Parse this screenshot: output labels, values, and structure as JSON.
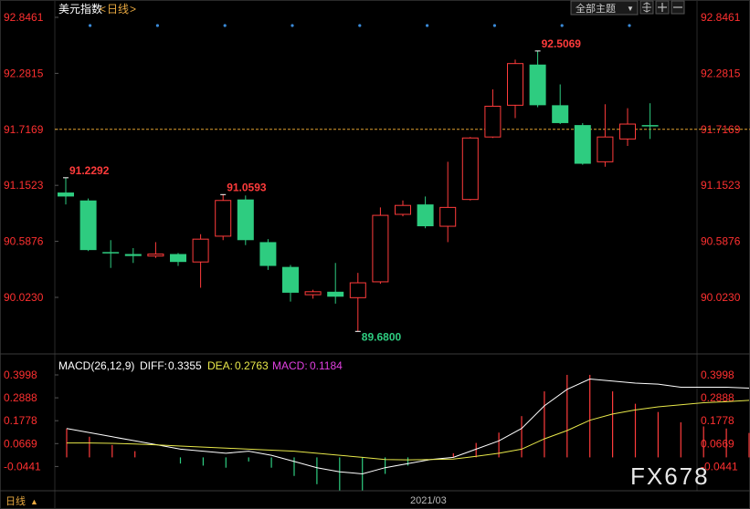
{
  "header": {
    "title": "美元指数",
    "period_open": "<",
    "period": "日线",
    "period_close": ">",
    "theme_selector": "全部主题",
    "theme_arrow": "▼"
  },
  "footer": {
    "period_label": "日线",
    "period_arrow": "▲",
    "date_label": "2021/03"
  },
  "watermark": "FX678",
  "colors": {
    "up": "#ff3b3b",
    "down": "#2ecc80",
    "grid": "#2a2a2a",
    "axis_text": "#ff3030",
    "diff_line": "#ffffff",
    "dea_line": "#e8e84a",
    "macd_text": "#e040e0",
    "current_price_line": "#e0a030",
    "marker_dots": "#3a8ad8"
  },
  "chart_data": [
    {
      "type": "candlestick",
      "title": "美元指数 日线",
      "y_ticks": [
        "92.8461",
        "92.2815",
        "91.7169",
        "91.1523",
        "90.5876",
        "90.0230"
      ],
      "ylim": [
        89.68,
        92.8461
      ],
      "current_price": 91.7169,
      "annotations": [
        {
          "text": "91.2292",
          "index": 0,
          "value": 91.2292
        },
        {
          "text": "91.0593",
          "index": 7,
          "value": 91.0593
        },
        {
          "text": "89.6800",
          "index": 13,
          "value": 89.68
        },
        {
          "text": "92.5069",
          "index": 21,
          "value": 92.5069
        }
      ],
      "candles": [
        {
          "open": 91.08,
          "close": 91.04,
          "high": 91.2292,
          "low": 90.96
        },
        {
          "open": 91.0,
          "close": 90.5,
          "high": 91.02,
          "low": 90.49
        },
        {
          "open": 90.48,
          "close": 90.47,
          "high": 90.6,
          "low": 90.32
        },
        {
          "open": 90.46,
          "close": 90.44,
          "high": 90.52,
          "low": 90.37
        },
        {
          "open": 90.44,
          "close": 90.46,
          "high": 90.58,
          "low": 90.42
        },
        {
          "open": 90.46,
          "close": 90.38,
          "high": 90.47,
          "low": 90.34
        },
        {
          "open": 90.38,
          "close": 90.61,
          "high": 90.66,
          "low": 90.12
        },
        {
          "open": 90.64,
          "close": 91.0,
          "high": 91.0593,
          "low": 90.6
        },
        {
          "open": 91.01,
          "close": 90.6,
          "high": 91.05,
          "low": 90.55
        },
        {
          "open": 90.58,
          "close": 90.34,
          "high": 90.61,
          "low": 90.3
        },
        {
          "open": 90.33,
          "close": 90.07,
          "high": 90.35,
          "low": 89.98
        },
        {
          "open": 90.05,
          "close": 90.08,
          "high": 90.1,
          "low": 90.01
        },
        {
          "open": 90.08,
          "close": 90.03,
          "high": 90.37,
          "low": 89.96
        },
        {
          "open": 90.02,
          "close": 90.17,
          "high": 90.27,
          "low": 89.68
        },
        {
          "open": 90.18,
          "close": 90.85,
          "high": 90.93,
          "low": 90.16
        },
        {
          "open": 90.86,
          "close": 90.95,
          "high": 91.0,
          "low": 90.84
        },
        {
          "open": 90.96,
          "close": 90.74,
          "high": 91.04,
          "low": 90.72
        },
        {
          "open": 90.74,
          "close": 90.93,
          "high": 91.39,
          "low": 90.58
        },
        {
          "open": 91.01,
          "close": 91.63,
          "high": 91.64,
          "low": 91.0
        },
        {
          "open": 91.64,
          "close": 91.95,
          "high": 92.12,
          "low": 91.63
        },
        {
          "open": 91.96,
          "close": 92.38,
          "high": 92.42,
          "low": 91.83
        },
        {
          "open": 92.37,
          "close": 91.96,
          "high": 92.5069,
          "low": 91.94
        },
        {
          "open": 91.96,
          "close": 91.78,
          "high": 92.17,
          "low": 91.77
        },
        {
          "open": 91.76,
          "close": 91.37,
          "high": 91.78,
          "low": 91.36
        },
        {
          "open": 91.39,
          "close": 91.64,
          "high": 91.97,
          "low": 91.34
        },
        {
          "open": 91.62,
          "close": 91.77,
          "high": 91.93,
          "low": 91.55
        },
        {
          "open": 91.76,
          "close": 91.75,
          "high": 91.98,
          "low": 91.62
        }
      ]
    },
    {
      "type": "macd",
      "legend": {
        "name": "MACD(26,12,9)",
        "diff_label": "DIFF:",
        "diff": "0.3355",
        "dea_label": "DEA:",
        "dea": "0.2763",
        "macd_label": "MACD:",
        "macd": "0.1184"
      },
      "y_ticks": [
        "0.3998",
        "0.2888",
        "0.1778",
        "0.0669",
        "-0.0441"
      ],
      "ylim": [
        -0.1,
        0.4
      ],
      "diff": [
        0.14,
        0.12,
        0.1,
        0.08,
        0.06,
        0.04,
        0.03,
        0.02,
        0.03,
        0.01,
        -0.02,
        -0.05,
        -0.07,
        -0.08,
        -0.05,
        -0.03,
        -0.01,
        0.0,
        0.04,
        0.08,
        0.14,
        0.25,
        0.33,
        0.38,
        0.37,
        0.36,
        0.355,
        0.34,
        0.34,
        0.34,
        0.3355
      ],
      "dea": [
        0.07,
        0.07,
        0.068,
        0.065,
        0.06,
        0.055,
        0.05,
        0.045,
        0.04,
        0.035,
        0.03,
        0.02,
        0.01,
        0.0,
        -0.01,
        -0.012,
        -0.01,
        -0.008,
        0.005,
        0.02,
        0.04,
        0.09,
        0.13,
        0.18,
        0.21,
        0.23,
        0.245,
        0.255,
        0.265,
        0.27,
        0.2763
      ],
      "macd": [
        0.14,
        0.1,
        0.06,
        0.03,
        0.0,
        -0.03,
        -0.04,
        -0.05,
        -0.02,
        -0.05,
        -0.09,
        -0.13,
        -0.16,
        -0.16,
        -0.08,
        -0.04,
        0.0,
        0.02,
        0.07,
        0.12,
        0.2,
        0.32,
        0.4,
        0.4,
        0.32,
        0.26,
        0.22,
        0.17,
        0.15,
        0.14,
        0.1184
      ]
    }
  ]
}
